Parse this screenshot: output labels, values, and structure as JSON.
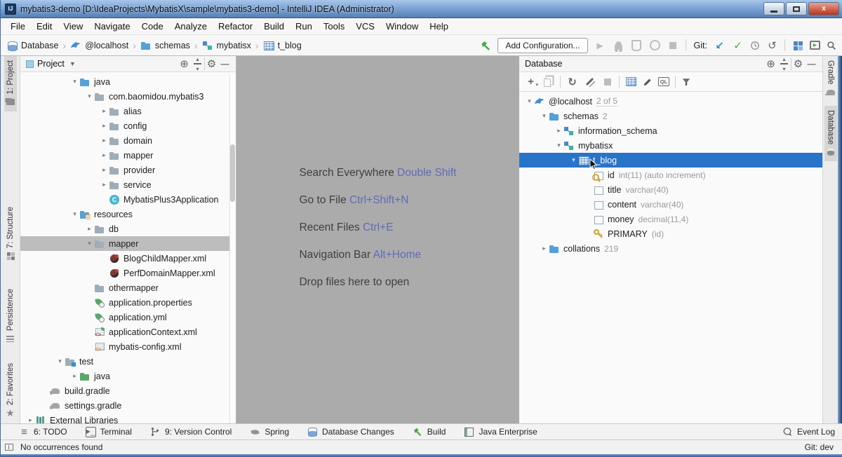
{
  "window": {
    "title": "mybatis3-demo [D:\\IdeaProjects\\MybatisX\\sample\\mybatis3-demo] - IntelliJ IDEA (Administrator)"
  },
  "menu": {
    "items": [
      "File",
      "Edit",
      "View",
      "Navigate",
      "Code",
      "Analyze",
      "Refactor",
      "Build",
      "Run",
      "Tools",
      "VCS",
      "Window",
      "Help"
    ]
  },
  "navbar": {
    "breadcrumbs": [
      {
        "icon": "db-stack",
        "label": "Database"
      },
      {
        "icon": "mysql",
        "label": "@localhost"
      },
      {
        "icon": "folder-blue",
        "label": "schemas"
      },
      {
        "icon": "schema",
        "label": "mybatisx"
      },
      {
        "icon": "table",
        "label": "t_blog"
      }
    ],
    "add_configuration_label": "Add Configuration...",
    "git_label": "Git:"
  },
  "left_stripe": {
    "tabs": [
      {
        "icon": "folder",
        "label": "1: Project",
        "active": true
      },
      {
        "icon": "structure",
        "label": "7: Structure",
        "active": false
      },
      {
        "icon": "persistence",
        "label": "Persistence",
        "active": false
      },
      {
        "icon": "star",
        "label": "2: Favorites",
        "active": false
      }
    ]
  },
  "right_stripe": {
    "tabs": [
      {
        "icon": "gradle",
        "label": "Gradle",
        "active": false
      },
      {
        "icon": "dbtab",
        "label": "Database",
        "active": true
      }
    ]
  },
  "project_panel": {
    "title": "Project",
    "tree": [
      {
        "level": 3,
        "arrow": "open",
        "icon": "folder-blue",
        "label": "java"
      },
      {
        "level": 4,
        "arrow": "open",
        "icon": "folder-gray",
        "label": "com.baomidou.mybatis3"
      },
      {
        "level": 5,
        "arrow": "closed",
        "icon": "folder-gray",
        "label": "alias"
      },
      {
        "level": 5,
        "arrow": "closed",
        "icon": "folder-gray",
        "label": "config"
      },
      {
        "level": 5,
        "arrow": "closed",
        "icon": "folder-gray",
        "label": "domain"
      },
      {
        "level": 5,
        "arrow": "closed",
        "icon": "folder-gray",
        "label": "mapper"
      },
      {
        "level": 5,
        "arrow": "closed",
        "icon": "folder-gray",
        "label": "provider"
      },
      {
        "level": 5,
        "arrow": "closed",
        "icon": "folder-gray",
        "label": "service"
      },
      {
        "level": 5,
        "arrow": "none",
        "icon": "class",
        "label": "MybatisPlus3Application"
      },
      {
        "level": 3,
        "arrow": "open",
        "icon": "folder-resources",
        "label": "resources"
      },
      {
        "level": 4,
        "arrow": "closed",
        "icon": "folder-gray",
        "label": "db"
      },
      {
        "level": 4,
        "arrow": "open",
        "icon": "folder-gray",
        "label": "mapper",
        "selected": "gray"
      },
      {
        "level": 5,
        "arrow": "none",
        "icon": "mybatis",
        "label": "BlogChildMapper.xml"
      },
      {
        "level": 5,
        "arrow": "none",
        "icon": "mybatis",
        "label": "PerfDomainMapper.xml"
      },
      {
        "level": 4,
        "arrow": "none",
        "icon": "folder-gray",
        "label": "othermapper"
      },
      {
        "level": 4,
        "arrow": "none",
        "icon": "props",
        "label": "application.properties"
      },
      {
        "level": 4,
        "arrow": "none",
        "icon": "props",
        "label": "application.yml"
      },
      {
        "level": 4,
        "arrow": "none",
        "icon": "springxml",
        "label": "applicationContext.xml"
      },
      {
        "level": 4,
        "arrow": "none",
        "icon": "xmlcfg",
        "label": "mybatis-config.xml"
      },
      {
        "level": 2,
        "arrow": "open",
        "icon": "folder-test",
        "label": "test"
      },
      {
        "level": 3,
        "arrow": "closed",
        "icon": "folder-green",
        "label": "java"
      },
      {
        "level": 1,
        "arrow": "none",
        "icon": "gradle",
        "label": "build.gradle"
      },
      {
        "level": 1,
        "arrow": "none",
        "icon": "gradle",
        "label": "settings.gradle"
      },
      {
        "level": 0,
        "arrow": "closed",
        "icon": "libs",
        "label": "External Libraries"
      }
    ]
  },
  "editor": {
    "shortcuts": [
      {
        "label": "Search Everywhere ",
        "keys": "Double Shift"
      },
      {
        "label": "Go to File ",
        "keys": "Ctrl+Shift+N"
      },
      {
        "label": "Recent Files ",
        "keys": "Ctrl+E"
      },
      {
        "label": "Navigation Bar ",
        "keys": "Alt+Home"
      },
      {
        "label": "Drop files here to open",
        "keys": ""
      }
    ]
  },
  "database_panel": {
    "title": "Database",
    "tree": [
      {
        "level": 0,
        "arrow": "open",
        "icon": "mysql",
        "label": "@localhost",
        "suffix": "2 of 5",
        "suffix_boxed": true
      },
      {
        "level": 1,
        "arrow": "open",
        "icon": "folder-blue",
        "label": "schemas",
        "suffix": "2"
      },
      {
        "level": 2,
        "arrow": "closed",
        "icon": "schema",
        "label": "information_schema"
      },
      {
        "level": 2,
        "arrow": "open",
        "icon": "schema",
        "label": "mybatisx"
      },
      {
        "level": 3,
        "arrow": "open",
        "icon": "table",
        "label": "t_blog",
        "selected": "blue",
        "cursor": true
      },
      {
        "level": 4,
        "arrow": "none",
        "icon": "col-key",
        "label": "id",
        "suffix": "int(11) (auto increment)"
      },
      {
        "level": 4,
        "arrow": "none",
        "icon": "col",
        "label": "title",
        "suffix": "varchar(40)"
      },
      {
        "level": 4,
        "arrow": "none",
        "icon": "col",
        "label": "content",
        "suffix": "varchar(40)"
      },
      {
        "level": 4,
        "arrow": "none",
        "icon": "col",
        "label": "money",
        "suffix": "decimal(11,4)"
      },
      {
        "level": 4,
        "arrow": "none",
        "icon": "keygold",
        "label": "PRIMARY",
        "suffix": "(id)"
      },
      {
        "level": 1,
        "arrow": "closed",
        "icon": "folder-blue",
        "label": "collations",
        "suffix": "219"
      }
    ]
  },
  "bottom_bar": {
    "items": [
      {
        "icon": "todo",
        "label": "6: TODO"
      },
      {
        "icon": "terminal",
        "label": "Terminal"
      },
      {
        "icon": "branch",
        "label": "9: Version Control"
      },
      {
        "icon": "spring",
        "label": "Spring"
      },
      {
        "icon": "dbchanges",
        "label": "Database Changes"
      },
      {
        "icon": "hammer",
        "label": "Build"
      },
      {
        "icon": "javaee",
        "label": "Java Enterprise"
      }
    ],
    "right_label": "Event Log"
  },
  "status_bar": {
    "message": "No occurrences found",
    "git": "Git: dev"
  },
  "colors": {
    "selection_blue": "#2874c9",
    "inactive_selection": "#bdbdbd",
    "editor_background": "#ababab",
    "shortcut_key_text": "#5e6cb8",
    "titlebar_blue": "#7ea5d6",
    "key_gold": "#d6a437",
    "mysql_blue": "#3e8fd0",
    "commit_green": "#4aa54a"
  }
}
